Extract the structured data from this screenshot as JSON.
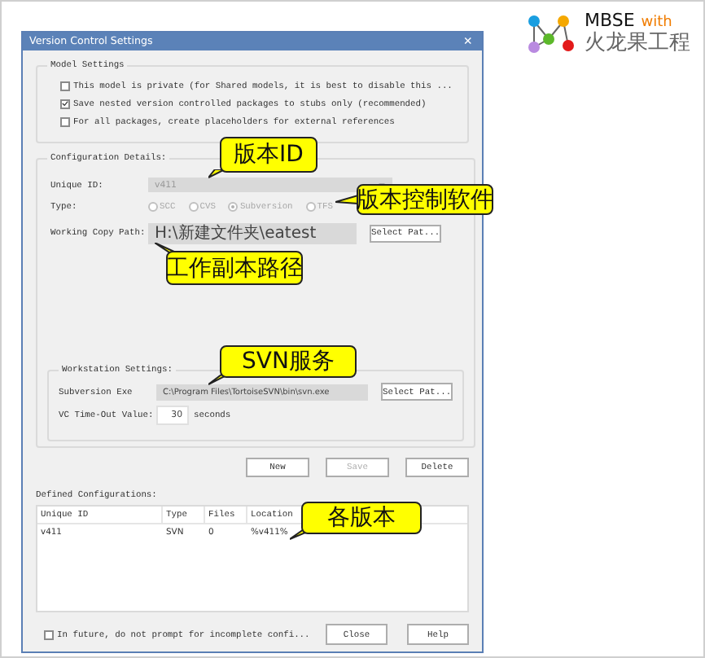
{
  "logo": {
    "title": "MBSE",
    "suffix": "with",
    "subtitle": "火龙果工程"
  },
  "window": {
    "title": "Version Control Settings",
    "close": "×"
  },
  "model_settings": {
    "label": "Model Settings",
    "options": [
      {
        "label": "This model is private (for Shared models, it is best to disable this ...",
        "checked": false
      },
      {
        "label": "Save nested version controlled packages to stubs only (recommended)",
        "checked": true
      },
      {
        "label": "For all packages, create placeholders for external references",
        "checked": false
      }
    ]
  },
  "configuration": {
    "label": "Configuration Details:",
    "unique_id": {
      "label": "Unique ID:",
      "value": "v411"
    },
    "type": {
      "label": "Type:",
      "options": [
        {
          "label": "SCC",
          "selected": false
        },
        {
          "label": "CVS",
          "selected": false
        },
        {
          "label": "Subversion",
          "selected": true
        },
        {
          "label": "TFS",
          "selected": false
        }
      ]
    },
    "working_copy": {
      "label": "Working Copy Path:",
      "value": "H:\\新建文件夹\\eatest",
      "button": "Select Pat..."
    }
  },
  "workstation": {
    "label": "Workstation Settings:",
    "exe": {
      "label": "Subversion Exe",
      "value": "C:\\Program Files\\TortoiseSVN\\bin\\svn.exe",
      "button": "Select Pat..."
    },
    "timeout": {
      "label": "VC Time-Out Value:",
      "value": "30",
      "unit": "seconds"
    }
  },
  "actions": [
    {
      "label": "New",
      "disabled": false
    },
    {
      "label": "Save",
      "disabled": true
    },
    {
      "label": "Delete",
      "disabled": false
    }
  ],
  "defined": {
    "label": "Defined Configurations:",
    "columns": [
      "Unique ID",
      "Type",
      "Files",
      "Location"
    ],
    "rows": [
      [
        "v411",
        "SVN",
        "0",
        "%v411%"
      ]
    ]
  },
  "footer": {
    "option": {
      "label": "In future, do not prompt for incomplete confi...",
      "checked": false
    },
    "buttons": [
      "Close",
      "Help"
    ]
  },
  "callouts": [
    {
      "text": "版本ID"
    },
    {
      "text": "版本控制软件"
    },
    {
      "text": "工作副本路径"
    },
    {
      "text": "SVN服务"
    },
    {
      "text": "各版本"
    }
  ]
}
